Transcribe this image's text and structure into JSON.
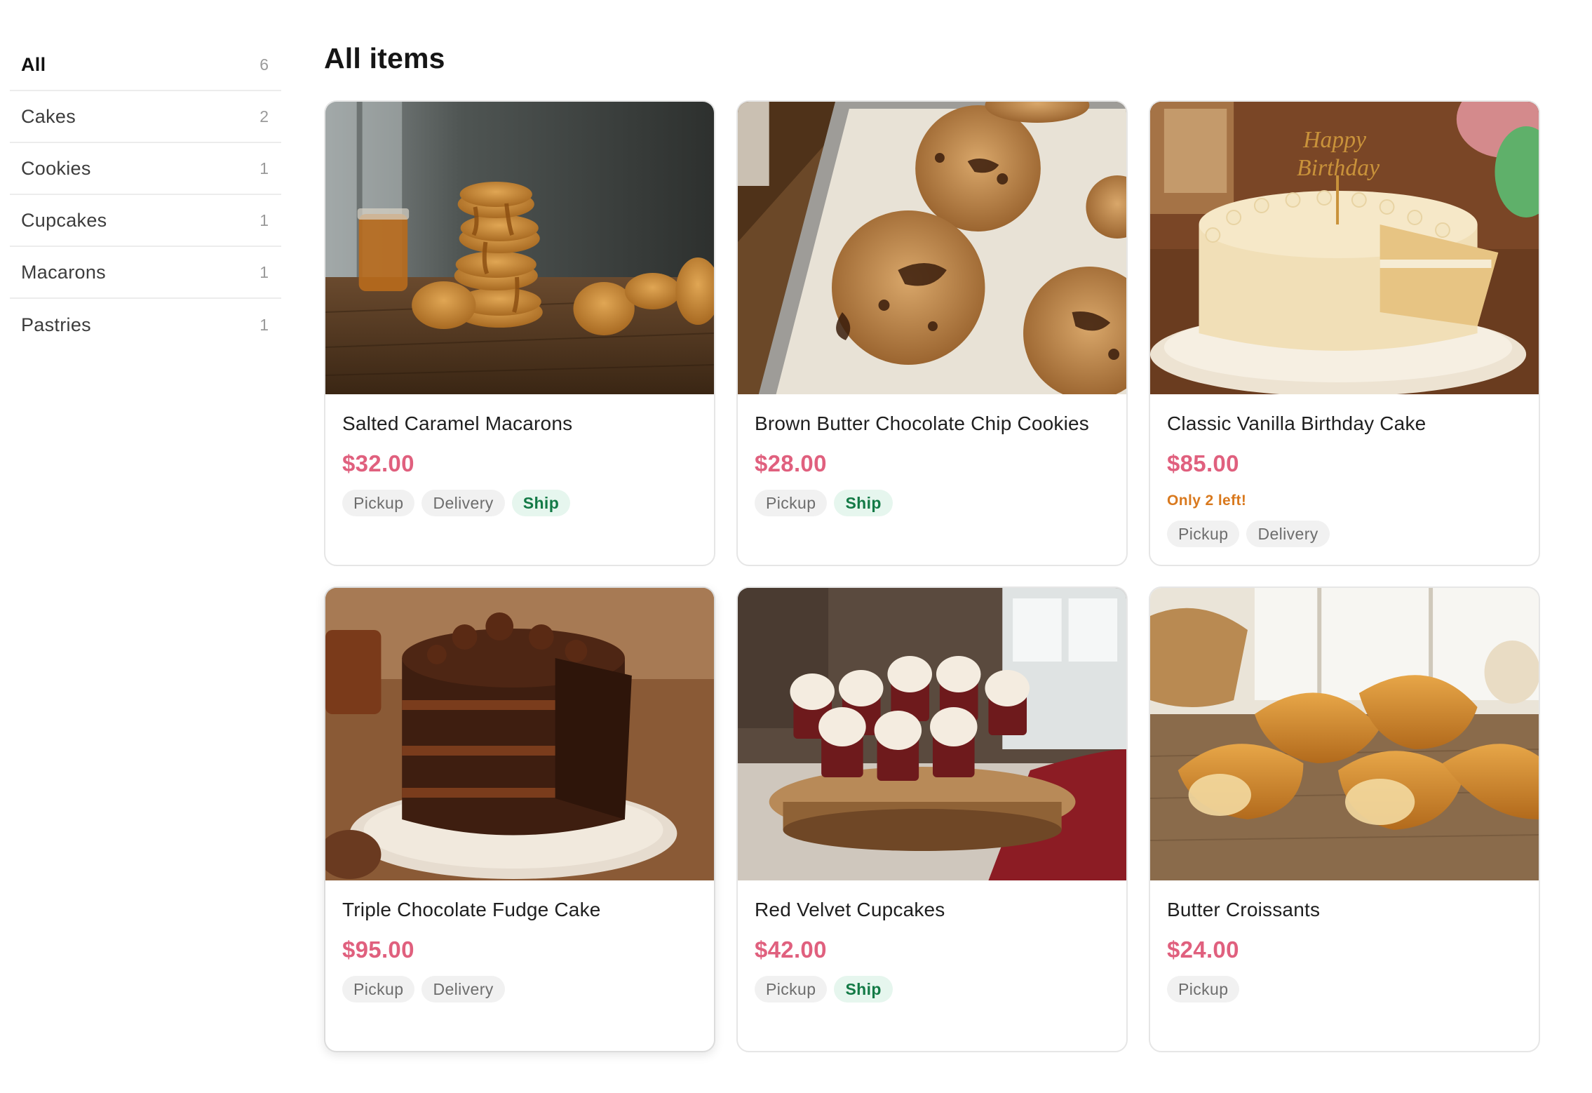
{
  "sidebar": {
    "categories": [
      {
        "label": "All",
        "count": "6",
        "active": true
      },
      {
        "label": "Cakes",
        "count": "2"
      },
      {
        "label": "Cookies",
        "count": "1"
      },
      {
        "label": "Cupcakes",
        "count": "1"
      },
      {
        "label": "Macarons",
        "count": "1"
      },
      {
        "label": "Pastries",
        "count": "1"
      }
    ]
  },
  "main": {
    "title": "All items",
    "products": [
      {
        "name": "Salted Caramel Macarons",
        "price": "$32.00",
        "stock_note": "",
        "tags": [
          "Pickup",
          "Delivery",
          "Ship"
        ],
        "image": "macarons-photo"
      },
      {
        "name": "Brown Butter Chocolate Chip Cookies",
        "price": "$28.00",
        "stock_note": "",
        "tags": [
          "Pickup",
          "Ship"
        ],
        "image": "cookies-photo"
      },
      {
        "name": "Classic Vanilla Birthday Cake",
        "price": "$85.00",
        "stock_note": "Only 2 left!",
        "tags": [
          "Pickup",
          "Delivery"
        ],
        "image": "birthday-cake-photo"
      },
      {
        "name": "Triple Chocolate Fudge Cake",
        "price": "$95.00",
        "stock_note": "",
        "tags": [
          "Pickup",
          "Delivery"
        ],
        "image": "chocolate-cake-photo"
      },
      {
        "name": "Red Velvet Cupcakes",
        "price": "$42.00",
        "stock_note": "",
        "tags": [
          "Pickup",
          "Ship"
        ],
        "image": "cupcakes-photo"
      },
      {
        "name": "Butter Croissants",
        "price": "$24.00",
        "stock_note": "",
        "tags": [
          "Pickup"
        ],
        "image": "croissants-photo"
      }
    ]
  },
  "colors": {
    "price": "#e0607e",
    "stock_warning": "#d9791e",
    "ship_tag_bg": "#e6f6ee",
    "ship_tag_text": "#137a46",
    "tag_bg": "#f1f1f1"
  }
}
